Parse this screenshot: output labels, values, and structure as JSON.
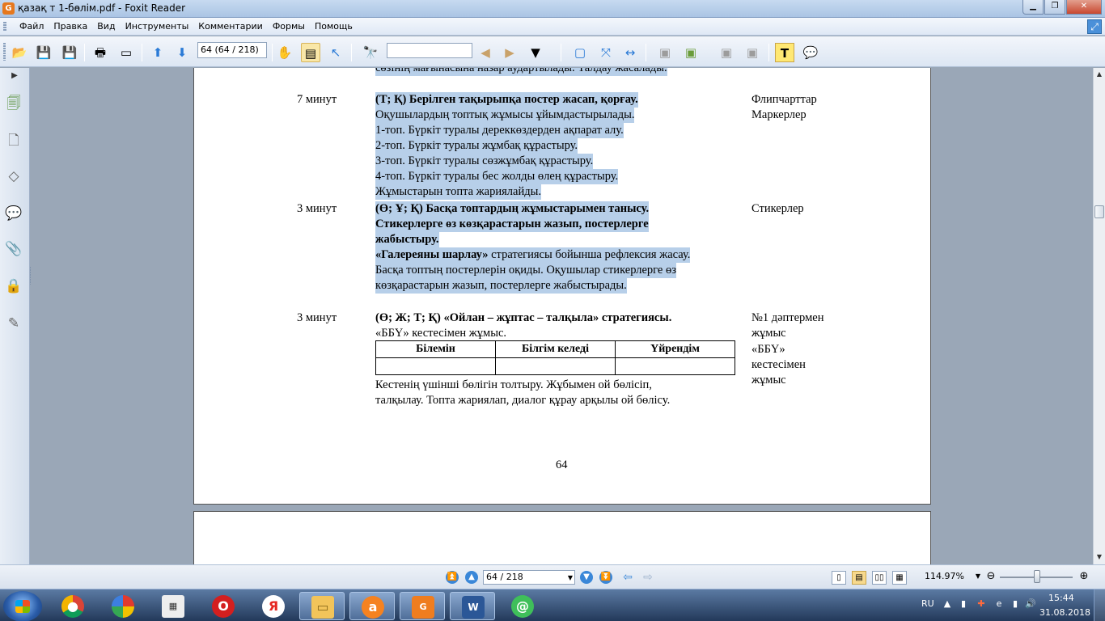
{
  "window": {
    "title": "қазақ т 1-бөлім.pdf - Foxit Reader",
    "buttons": {
      "minimize": "▁",
      "maximize": "❐",
      "close": "✕"
    }
  },
  "menu": [
    "Файл",
    "Правка",
    "Вид",
    "Инструменты",
    "Комментарии",
    "Формы",
    "Помощь"
  ],
  "toolbar": {
    "page_field": "64 (64 / 218)",
    "find_placeholder": ""
  },
  "document": {
    "partial_top": "сөзінің мағынасына назар аудартылады. Талдау жасалады.",
    "rows": [
      {
        "time": "7 минут",
        "lines": [
          {
            "text": "(Т; Қ) Берілген тақырыпқа постер жасап, қорғау.",
            "bold": true,
            "hl": true
          },
          {
            "text": "Оқушылардың топтық жұмысы ұйымдастырылады.",
            "bold": false,
            "hl": true
          },
          {
            "text": "1-топ. Бүркіт туралы дереккөздерден ақпарат алу.",
            "bold": false,
            "hl": true
          },
          {
            "text": "2-топ. Бүркіт туралы жұмбақ құрастыру.",
            "bold": false,
            "hl": true
          },
          {
            "text": "3-топ. Бүркіт туралы сөзжұмбақ құрастыру.",
            "bold": false,
            "hl": true
          },
          {
            "text": "4-топ. Бүркіт туралы бес жолды өлең құрастыру.",
            "bold": false,
            "hl": true
          },
          {
            "text": "Жұмыстарын топта жариялайды.",
            "bold": false,
            "hl": true
          }
        ],
        "resources": [
          "Флипчарттар",
          "Маркерлер"
        ]
      },
      {
        "time": "3 минут",
        "lines": [
          {
            "text": "(Ө; Ұ; Қ) Басқа топтардың жұмыстарымен танысу.",
            "bold": true,
            "hl": true
          },
          {
            "text": "Стикерлерге өз көзқарастарын жазып, постерлерге",
            "bold": true,
            "hl": true
          },
          {
            "text": "жабыстыру.",
            "bold": true,
            "hl": true
          },
          {
            "text_bold": "«Галереяны шарлау»",
            "text": " стратегиясы бойынша рефлексия жасау.",
            "hl": true
          },
          {
            "text": "Басқа топтың постерлерін оқиды. Оқушылар стикерлерге өз",
            "bold": false,
            "hl": true
          },
          {
            "text": "көзқарастарын жазып, постерлерге жабыстырады.",
            "bold": false,
            "hl": true
          }
        ],
        "resources": [
          "Стикерлер"
        ]
      },
      {
        "time": "3 минут",
        "lines": [
          {
            "text": "(Ө; Ж; Т; Қ) «Ойлан – жұптас – талқыла» стратегиясы.",
            "bold": true,
            "hl": false
          },
          {
            "text": "«ББҮ» кестесімен жұмыс.",
            "bold": false,
            "hl": false
          }
        ],
        "table_headers": [
          "Білемін",
          "Білгім келеді",
          "Үйрендім"
        ],
        "after": [
          "Кестенің үшінші бөлігін толтыру. Жұбымен ой бөлісіп,",
          "талқылау. Топта жариялап, диалог құрау арқылы ой бөлісу."
        ],
        "resources": [
          "№1 дәптермен",
          "жұмыс",
          "«ББҮ»",
          "кестесімен",
          "жұмыс"
        ]
      }
    ],
    "page_number": "64"
  },
  "statusbar": {
    "page_field": "64 / 218",
    "zoom": "114.97%"
  },
  "taskbar": {
    "language": "RU",
    "time": "15:44",
    "date": "31.08.2018"
  },
  "colors": {
    "highlight": "#b7cfe9",
    "page_bg": "#ffffff",
    "workspace": "#9aa7b7",
    "foxit_orange": "#e6781e"
  }
}
